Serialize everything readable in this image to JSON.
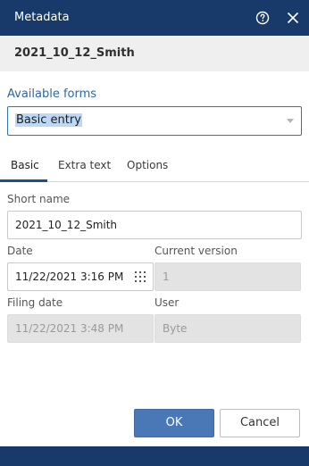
{
  "dialog": {
    "title": "Metadata",
    "header_name": "2021_10_12_Smith",
    "help_icon": "help-circle-icon",
    "close_icon": "close-icon"
  },
  "forms": {
    "label": "Available forms",
    "selected": "Basic entry"
  },
  "tabs": [
    {
      "label": "Basic",
      "active": true
    },
    {
      "label": "Extra text",
      "active": false
    },
    {
      "label": "Options",
      "active": false
    }
  ],
  "fields": {
    "short_name": {
      "label": "Short name",
      "value": "2021_10_12_Smith"
    },
    "date": {
      "label": "Date",
      "value": "11/22/2021 3:16 PM"
    },
    "current_version": {
      "label": "Current version",
      "value": "1"
    },
    "filing_date": {
      "label": "Filing date",
      "value": "11/22/2021 3:48 PM"
    },
    "user": {
      "label": "User",
      "value": "Byte"
    }
  },
  "buttons": {
    "ok": "OK",
    "cancel": "Cancel"
  },
  "colors": {
    "titlebar": "#173a6b",
    "accent": "#2f74bd",
    "ok_button": "#4a78b6"
  }
}
